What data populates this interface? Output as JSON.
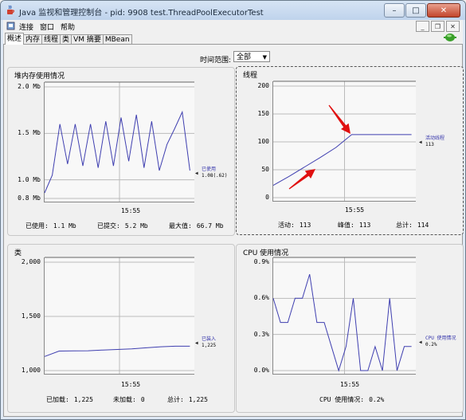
{
  "window": {
    "title": "Java 监视和管理控制台 - pid: 9908 test.ThreadPoolExecutorTest",
    "min": "–",
    "max": "□",
    "close": "✕"
  },
  "menu": {
    "items": [
      "连接",
      "窗口",
      "帮助"
    ],
    "child_min": "_",
    "child_restore": "❐",
    "child_close": "✕"
  },
  "tabs": [
    "概述",
    "内存",
    "线程",
    "类",
    "VM 摘要",
    "MBean"
  ],
  "time_range": {
    "label": "时间范围:",
    "value": "全部",
    "arrow": "▼"
  },
  "heap": {
    "title": "堆内存使用情况",
    "yticks": [
      "2.0 Mb",
      "1.5 Mb",
      "1.0 Mb",
      "0.8 Mb"
    ],
    "xtick": "15:55",
    "legend_name": "已使用",
    "legend_value": "1.08(.62)",
    "stats": [
      {
        "label": "已使用:",
        "value": "1.1  Mb"
      },
      {
        "label": "已提交:",
        "value": "5.2  Mb"
      },
      {
        "label": "最大值:",
        "value": "66.7  Mb"
      }
    ]
  },
  "threads": {
    "title": "线程",
    "yticks": [
      "200",
      "150",
      "100",
      "50",
      "0"
    ],
    "xtick": "15:55",
    "legend_name": "活动线程",
    "legend_value": "113",
    "stats": [
      {
        "label": "活动:",
        "value": "113"
      },
      {
        "label": "峰值:",
        "value": "113"
      },
      {
        "label": "总计:",
        "value": "114"
      }
    ]
  },
  "classes": {
    "title": "类",
    "yticks": [
      "2,000",
      "1,500",
      "1,000"
    ],
    "xtick": "15:55",
    "legend_name": "已装入",
    "legend_value": "1,225",
    "stats": [
      {
        "label": "已加载:",
        "value": "1,225"
      },
      {
        "label": "未加载:",
        "value": "0"
      },
      {
        "label": "总计:",
        "value": "1,225"
      }
    ]
  },
  "cpu": {
    "title": "CPU 使用情况",
    "yticks": [
      "0.9%",
      "0.6%",
      "0.3%",
      "0.0%"
    ],
    "xtick": "15:55",
    "legend_name": "CPU 使用情况",
    "legend_value": "0.2%",
    "stats": [
      {
        "label": "CPU 使用情况:",
        "value": "0.2%"
      }
    ]
  },
  "colors": {
    "series": "#3f3fb0",
    "arrow": "#e01010"
  },
  "chart_data": [
    {
      "type": "line",
      "title": "堆内存使用情况",
      "ylabel": "Mb",
      "ylim": [
        0.8,
        2.0
      ],
      "series": [
        {
          "name": "已使用",
          "values": [
            0.86,
            1.05,
            1.6,
            1.17,
            1.6,
            1.15,
            1.6,
            1.13,
            1.63,
            1.15,
            1.67,
            1.2,
            1.7,
            1.13,
            1.63,
            1.1,
            1.38,
            1.55,
            1.73,
            1.1
          ]
        }
      ]
    },
    {
      "type": "line",
      "title": "线程",
      "ylim": [
        0,
        200
      ],
      "series": [
        {
          "name": "活动线程",
          "values": [
            22,
            38,
            55,
            72,
            90,
            113,
            113,
            113,
            113,
            113,
            113
          ]
        }
      ]
    },
    {
      "type": "line",
      "title": "类",
      "ylim": [
        1000,
        2000
      ],
      "series": [
        {
          "name": "已装入",
          "values": [
            1130,
            1180,
            1182,
            1183,
            1190,
            1195,
            1200,
            1210,
            1220,
            1225,
            1225
          ]
        }
      ]
    },
    {
      "type": "line",
      "title": "CPU 使用情况",
      "ylabel": "%",
      "ylim": [
        0.0,
        0.9
      ],
      "series": [
        {
          "name": "CPU 使用情况",
          "values": [
            0.6,
            0.4,
            0.4,
            0.6,
            0.6,
            0.8,
            0.4,
            0.4,
            0.2,
            0.0,
            0.2,
            0.6,
            0.0,
            0.0,
            0.2,
            0.0,
            0.6,
            0.0,
            0.2,
            0.2
          ]
        }
      ]
    }
  ]
}
